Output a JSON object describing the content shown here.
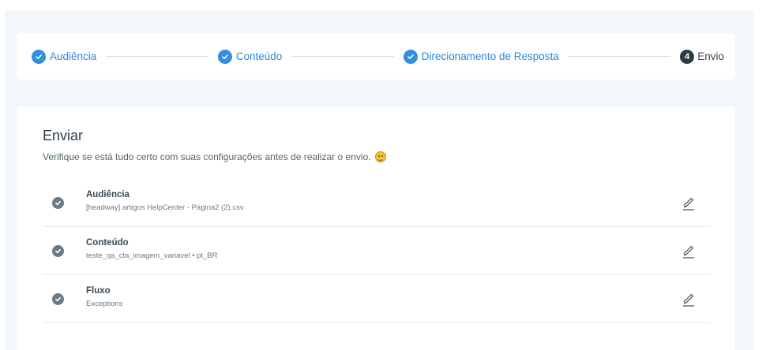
{
  "stepper": {
    "steps": [
      {
        "label": "Audiência",
        "state": "done"
      },
      {
        "label": "Conteúdo",
        "state": "done"
      },
      {
        "label": "Direcionamento de Resposta",
        "state": "done"
      },
      {
        "label": "Envio",
        "state": "current",
        "number": "4"
      }
    ]
  },
  "main": {
    "title": "Enviar",
    "subtitle": "Verifique se está tudo certo com suas configurações antes de realizar o envio.",
    "items": [
      {
        "title": "Audiência",
        "detail": "[headway] artigos HelpCenter - Página2 (2).csv"
      },
      {
        "title": "Conteúdo",
        "detail": "teste_qa_cta_imagem_variavel • pt_BR"
      },
      {
        "title": "Fluxo",
        "detail": "Exceptions"
      }
    ]
  },
  "colors": {
    "accent": "#2f8fe0",
    "current_step": "#2f3b44",
    "background": "#f4f7f9"
  }
}
